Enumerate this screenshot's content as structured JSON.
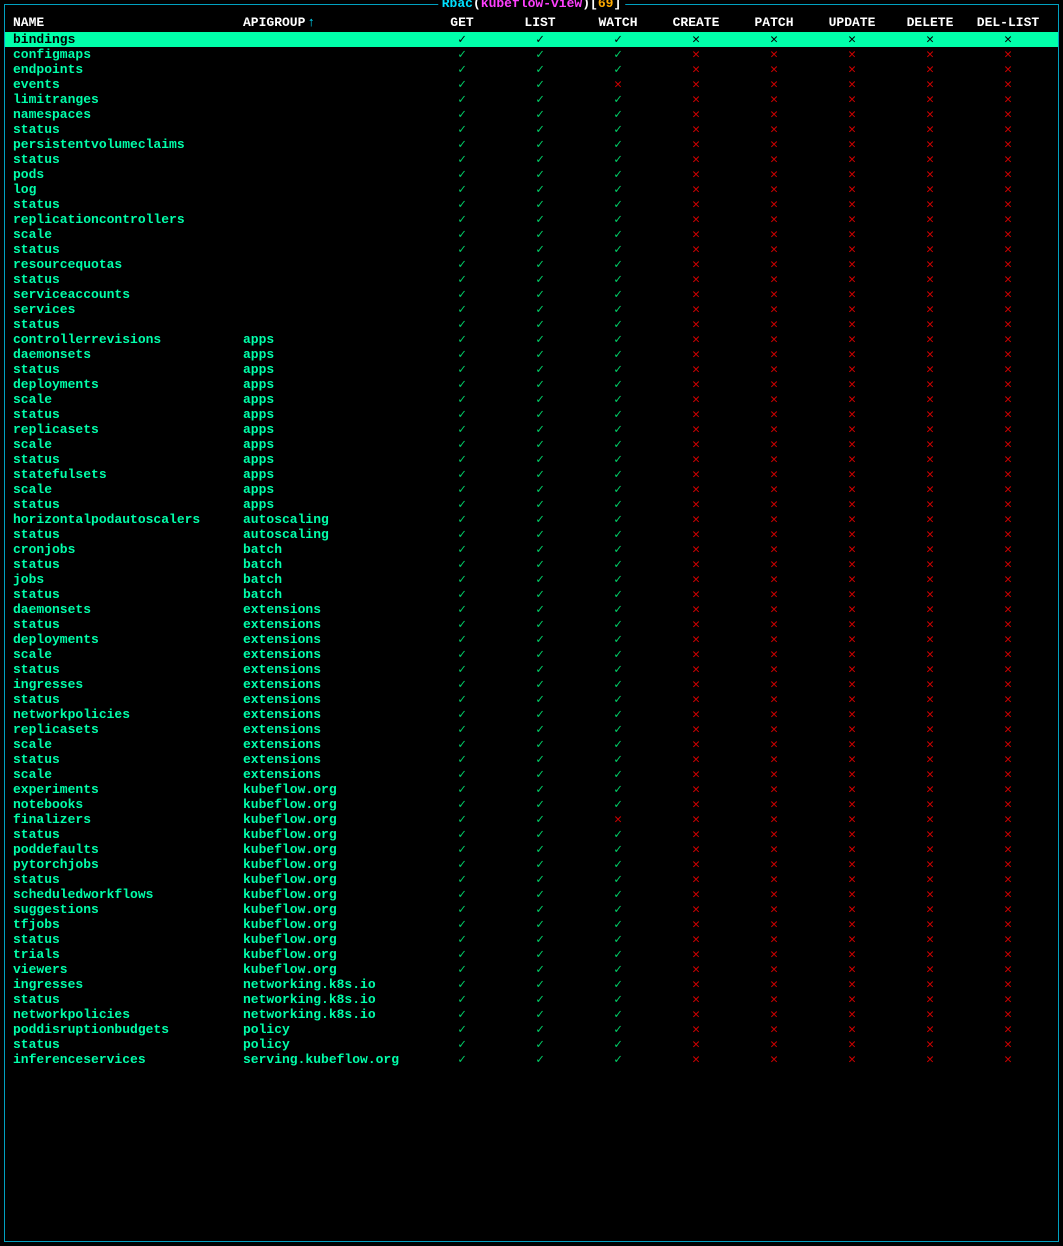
{
  "title": {
    "label": "Rbac",
    "resource_name": "kubeflow-view",
    "count": "69"
  },
  "columns": {
    "name": "NAME",
    "apigroup": "APIGROUP",
    "get": "GET",
    "list": "LIST",
    "watch": "WATCH",
    "create": "CREATE",
    "patch": "PATCH",
    "update": "UPDATE",
    "delete": "DELETE",
    "dellist": "DEL-LIST"
  },
  "sort_indicator": "↑",
  "glyphs": {
    "check": "✓",
    "cross": "✕"
  },
  "rows": [
    {
      "name": "bindings",
      "apigroup": "",
      "verbs": [
        1,
        1,
        1,
        0,
        0,
        0,
        0,
        0
      ],
      "selected": true
    },
    {
      "name": "configmaps",
      "apigroup": "",
      "verbs": [
        1,
        1,
        1,
        0,
        0,
        0,
        0,
        0
      ]
    },
    {
      "name": "endpoints",
      "apigroup": "",
      "verbs": [
        1,
        1,
        1,
        0,
        0,
        0,
        0,
        0
      ]
    },
    {
      "name": "events",
      "apigroup": "",
      "verbs": [
        1,
        1,
        0,
        0,
        0,
        0,
        0,
        0
      ]
    },
    {
      "name": "limitranges",
      "apigroup": "",
      "verbs": [
        1,
        1,
        1,
        0,
        0,
        0,
        0,
        0
      ]
    },
    {
      "name": "namespaces",
      "apigroup": "",
      "verbs": [
        1,
        1,
        1,
        0,
        0,
        0,
        0,
        0
      ]
    },
    {
      "name": "status",
      "apigroup": "",
      "verbs": [
        1,
        1,
        1,
        0,
        0,
        0,
        0,
        0
      ]
    },
    {
      "name": "persistentvolumeclaims",
      "apigroup": "",
      "verbs": [
        1,
        1,
        1,
        0,
        0,
        0,
        0,
        0
      ]
    },
    {
      "name": "status",
      "apigroup": "",
      "verbs": [
        1,
        1,
        1,
        0,
        0,
        0,
        0,
        0
      ]
    },
    {
      "name": "pods",
      "apigroup": "",
      "verbs": [
        1,
        1,
        1,
        0,
        0,
        0,
        0,
        0
      ]
    },
    {
      "name": "log",
      "apigroup": "",
      "verbs": [
        1,
        1,
        1,
        0,
        0,
        0,
        0,
        0
      ]
    },
    {
      "name": "status",
      "apigroup": "",
      "verbs": [
        1,
        1,
        1,
        0,
        0,
        0,
        0,
        0
      ]
    },
    {
      "name": "replicationcontrollers",
      "apigroup": "",
      "verbs": [
        1,
        1,
        1,
        0,
        0,
        0,
        0,
        0
      ]
    },
    {
      "name": "scale",
      "apigroup": "",
      "verbs": [
        1,
        1,
        1,
        0,
        0,
        0,
        0,
        0
      ]
    },
    {
      "name": "status",
      "apigroup": "",
      "verbs": [
        1,
        1,
        1,
        0,
        0,
        0,
        0,
        0
      ]
    },
    {
      "name": "resourcequotas",
      "apigroup": "",
      "verbs": [
        1,
        1,
        1,
        0,
        0,
        0,
        0,
        0
      ]
    },
    {
      "name": "status",
      "apigroup": "",
      "verbs": [
        1,
        1,
        1,
        0,
        0,
        0,
        0,
        0
      ]
    },
    {
      "name": "serviceaccounts",
      "apigroup": "",
      "verbs": [
        1,
        1,
        1,
        0,
        0,
        0,
        0,
        0
      ]
    },
    {
      "name": "services",
      "apigroup": "",
      "verbs": [
        1,
        1,
        1,
        0,
        0,
        0,
        0,
        0
      ]
    },
    {
      "name": "status",
      "apigroup": "",
      "verbs": [
        1,
        1,
        1,
        0,
        0,
        0,
        0,
        0
      ]
    },
    {
      "name": "controllerrevisions",
      "apigroup": "apps",
      "verbs": [
        1,
        1,
        1,
        0,
        0,
        0,
        0,
        0
      ]
    },
    {
      "name": "daemonsets",
      "apigroup": "apps",
      "verbs": [
        1,
        1,
        1,
        0,
        0,
        0,
        0,
        0
      ]
    },
    {
      "name": "status",
      "apigroup": "apps",
      "verbs": [
        1,
        1,
        1,
        0,
        0,
        0,
        0,
        0
      ]
    },
    {
      "name": "deployments",
      "apigroup": "apps",
      "verbs": [
        1,
        1,
        1,
        0,
        0,
        0,
        0,
        0
      ]
    },
    {
      "name": "scale",
      "apigroup": "apps",
      "verbs": [
        1,
        1,
        1,
        0,
        0,
        0,
        0,
        0
      ]
    },
    {
      "name": "status",
      "apigroup": "apps",
      "verbs": [
        1,
        1,
        1,
        0,
        0,
        0,
        0,
        0
      ]
    },
    {
      "name": "replicasets",
      "apigroup": "apps",
      "verbs": [
        1,
        1,
        1,
        0,
        0,
        0,
        0,
        0
      ]
    },
    {
      "name": "scale",
      "apigroup": "apps",
      "verbs": [
        1,
        1,
        1,
        0,
        0,
        0,
        0,
        0
      ]
    },
    {
      "name": "status",
      "apigroup": "apps",
      "verbs": [
        1,
        1,
        1,
        0,
        0,
        0,
        0,
        0
      ]
    },
    {
      "name": "statefulsets",
      "apigroup": "apps",
      "verbs": [
        1,
        1,
        1,
        0,
        0,
        0,
        0,
        0
      ]
    },
    {
      "name": "scale",
      "apigroup": "apps",
      "verbs": [
        1,
        1,
        1,
        0,
        0,
        0,
        0,
        0
      ]
    },
    {
      "name": "status",
      "apigroup": "apps",
      "verbs": [
        1,
        1,
        1,
        0,
        0,
        0,
        0,
        0
      ]
    },
    {
      "name": "horizontalpodautoscalers",
      "apigroup": "autoscaling",
      "verbs": [
        1,
        1,
        1,
        0,
        0,
        0,
        0,
        0
      ]
    },
    {
      "name": "status",
      "apigroup": "autoscaling",
      "verbs": [
        1,
        1,
        1,
        0,
        0,
        0,
        0,
        0
      ]
    },
    {
      "name": "cronjobs",
      "apigroup": "batch",
      "verbs": [
        1,
        1,
        1,
        0,
        0,
        0,
        0,
        0
      ]
    },
    {
      "name": "status",
      "apigroup": "batch",
      "verbs": [
        1,
        1,
        1,
        0,
        0,
        0,
        0,
        0
      ]
    },
    {
      "name": "jobs",
      "apigroup": "batch",
      "verbs": [
        1,
        1,
        1,
        0,
        0,
        0,
        0,
        0
      ]
    },
    {
      "name": "status",
      "apigroup": "batch",
      "verbs": [
        1,
        1,
        1,
        0,
        0,
        0,
        0,
        0
      ]
    },
    {
      "name": "daemonsets",
      "apigroup": "extensions",
      "verbs": [
        1,
        1,
        1,
        0,
        0,
        0,
        0,
        0
      ]
    },
    {
      "name": "status",
      "apigroup": "extensions",
      "verbs": [
        1,
        1,
        1,
        0,
        0,
        0,
        0,
        0
      ]
    },
    {
      "name": "deployments",
      "apigroup": "extensions",
      "verbs": [
        1,
        1,
        1,
        0,
        0,
        0,
        0,
        0
      ]
    },
    {
      "name": "scale",
      "apigroup": "extensions",
      "verbs": [
        1,
        1,
        1,
        0,
        0,
        0,
        0,
        0
      ]
    },
    {
      "name": "status",
      "apigroup": "extensions",
      "verbs": [
        1,
        1,
        1,
        0,
        0,
        0,
        0,
        0
      ]
    },
    {
      "name": "ingresses",
      "apigroup": "extensions",
      "verbs": [
        1,
        1,
        1,
        0,
        0,
        0,
        0,
        0
      ]
    },
    {
      "name": "status",
      "apigroup": "extensions",
      "verbs": [
        1,
        1,
        1,
        0,
        0,
        0,
        0,
        0
      ]
    },
    {
      "name": "networkpolicies",
      "apigroup": "extensions",
      "verbs": [
        1,
        1,
        1,
        0,
        0,
        0,
        0,
        0
      ]
    },
    {
      "name": "replicasets",
      "apigroup": "extensions",
      "verbs": [
        1,
        1,
        1,
        0,
        0,
        0,
        0,
        0
      ]
    },
    {
      "name": "scale",
      "apigroup": "extensions",
      "verbs": [
        1,
        1,
        1,
        0,
        0,
        0,
        0,
        0
      ]
    },
    {
      "name": "status",
      "apigroup": "extensions",
      "verbs": [
        1,
        1,
        1,
        0,
        0,
        0,
        0,
        0
      ]
    },
    {
      "name": "scale",
      "apigroup": "extensions",
      "verbs": [
        1,
        1,
        1,
        0,
        0,
        0,
        0,
        0
      ]
    },
    {
      "name": "experiments",
      "apigroup": "kubeflow.org",
      "verbs": [
        1,
        1,
        1,
        0,
        0,
        0,
        0,
        0
      ]
    },
    {
      "name": "notebooks",
      "apigroup": "kubeflow.org",
      "verbs": [
        1,
        1,
        1,
        0,
        0,
        0,
        0,
        0
      ]
    },
    {
      "name": "finalizers",
      "apigroup": "kubeflow.org",
      "verbs": [
        1,
        1,
        0,
        0,
        0,
        0,
        0,
        0
      ]
    },
    {
      "name": "status",
      "apigroup": "kubeflow.org",
      "verbs": [
        1,
        1,
        1,
        0,
        0,
        0,
        0,
        0
      ]
    },
    {
      "name": "poddefaults",
      "apigroup": "kubeflow.org",
      "verbs": [
        1,
        1,
        1,
        0,
        0,
        0,
        0,
        0
      ]
    },
    {
      "name": "pytorchjobs",
      "apigroup": "kubeflow.org",
      "verbs": [
        1,
        1,
        1,
        0,
        0,
        0,
        0,
        0
      ]
    },
    {
      "name": "status",
      "apigroup": "kubeflow.org",
      "verbs": [
        1,
        1,
        1,
        0,
        0,
        0,
        0,
        0
      ]
    },
    {
      "name": "scheduledworkflows",
      "apigroup": "kubeflow.org",
      "verbs": [
        1,
        1,
        1,
        0,
        0,
        0,
        0,
        0
      ]
    },
    {
      "name": "suggestions",
      "apigroup": "kubeflow.org",
      "verbs": [
        1,
        1,
        1,
        0,
        0,
        0,
        0,
        0
      ]
    },
    {
      "name": "tfjobs",
      "apigroup": "kubeflow.org",
      "verbs": [
        1,
        1,
        1,
        0,
        0,
        0,
        0,
        0
      ]
    },
    {
      "name": "status",
      "apigroup": "kubeflow.org",
      "verbs": [
        1,
        1,
        1,
        0,
        0,
        0,
        0,
        0
      ]
    },
    {
      "name": "trials",
      "apigroup": "kubeflow.org",
      "verbs": [
        1,
        1,
        1,
        0,
        0,
        0,
        0,
        0
      ]
    },
    {
      "name": "viewers",
      "apigroup": "kubeflow.org",
      "verbs": [
        1,
        1,
        1,
        0,
        0,
        0,
        0,
        0
      ]
    },
    {
      "name": "ingresses",
      "apigroup": "networking.k8s.io",
      "verbs": [
        1,
        1,
        1,
        0,
        0,
        0,
        0,
        0
      ]
    },
    {
      "name": "status",
      "apigroup": "networking.k8s.io",
      "verbs": [
        1,
        1,
        1,
        0,
        0,
        0,
        0,
        0
      ]
    },
    {
      "name": "networkpolicies",
      "apigroup": "networking.k8s.io",
      "verbs": [
        1,
        1,
        1,
        0,
        0,
        0,
        0,
        0
      ]
    },
    {
      "name": "poddisruptionbudgets",
      "apigroup": "policy",
      "verbs": [
        1,
        1,
        1,
        0,
        0,
        0,
        0,
        0
      ]
    },
    {
      "name": "status",
      "apigroup": "policy",
      "verbs": [
        1,
        1,
        1,
        0,
        0,
        0,
        0,
        0
      ]
    },
    {
      "name": "inferenceservices",
      "apigroup": "serving.kubeflow.org",
      "verbs": [
        1,
        1,
        1,
        0,
        0,
        0,
        0,
        0
      ]
    }
  ]
}
